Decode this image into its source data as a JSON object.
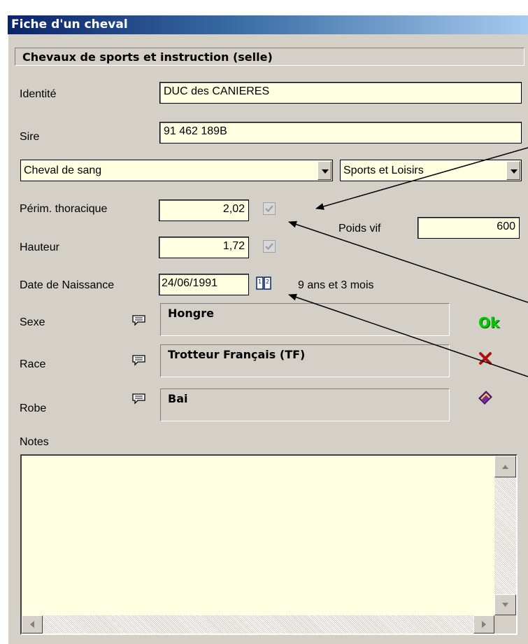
{
  "window": {
    "title": "Fiche d'un cheval"
  },
  "section": {
    "title": "Chevaux de sports et instruction (selle)"
  },
  "identite": {
    "label": "Identité",
    "value": "DUC des CANIERES"
  },
  "sire": {
    "label": "Sire",
    "value": "91 462 189B"
  },
  "type_combo": {
    "value": "Cheval de sang"
  },
  "usage_combo": {
    "value": "Sports et Loisirs"
  },
  "perimetre": {
    "label": "Périm. thoracique",
    "value": "2,02",
    "checked": true
  },
  "poids": {
    "label": "Poids vif",
    "value": "600"
  },
  "hauteur": {
    "label": "Hauteur",
    "value": "1,72",
    "checked": true
  },
  "naissance": {
    "label": "Date de Naissance",
    "value": "24/06/1991",
    "age": "9 ans et 3 mois"
  },
  "sexe": {
    "label": "Sexe",
    "value": "Hongre"
  },
  "race": {
    "label": "Race",
    "value": "Trotteur Français (TF)"
  },
  "robe": {
    "label": "Robe",
    "value": "Bai"
  },
  "notes": {
    "label": "Notes",
    "value": ""
  },
  "buttons": {
    "ok_label": "Ok"
  },
  "colors": {
    "ok": "#00c800",
    "cancel": "#b01010",
    "title_start": "#0a246a",
    "field_bg": "#ffffe1"
  }
}
